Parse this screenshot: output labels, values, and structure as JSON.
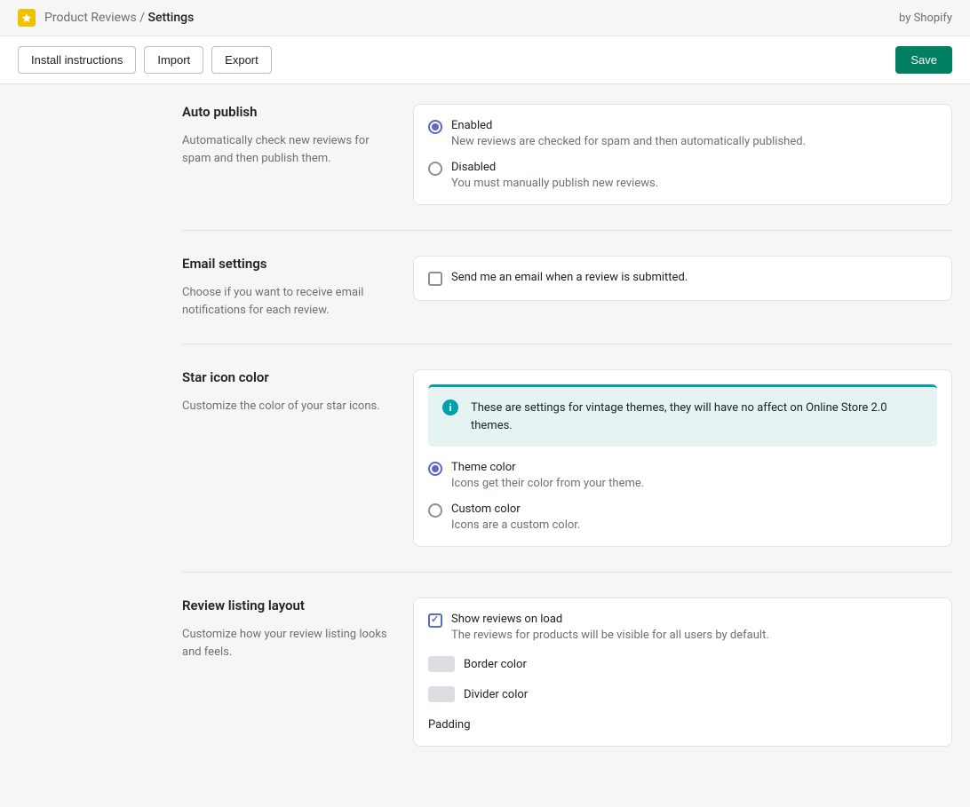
{
  "header": {
    "breadcrumb_parent": "Product Reviews",
    "breadcrumb_sep": " / ",
    "breadcrumb_current": "Settings",
    "by_shopify": "by Shopify"
  },
  "toolbar": {
    "install": "Install instructions",
    "import": "Import",
    "export": "Export",
    "save": "Save"
  },
  "sections": {
    "auto_publish": {
      "title": "Auto publish",
      "desc": "Automatically check new reviews for spam and then publish them.",
      "enabled_label": "Enabled",
      "enabled_desc": "New reviews are checked for spam and then automatically published.",
      "disabled_label": "Disabled",
      "disabled_desc": "You must manually publish new reviews."
    },
    "email": {
      "title": "Email settings",
      "desc": "Choose if you want to receive email notifications for each review.",
      "send_label": "Send me an email when a review is submitted."
    },
    "star": {
      "title": "Star icon color",
      "desc": "Customize the color of your star icons.",
      "banner": "These are settings for vintage themes, they will have no affect on Online Store 2.0 themes.",
      "theme_label": "Theme color",
      "theme_desc": "Icons get their color from your theme.",
      "custom_label": "Custom color",
      "custom_desc": "Icons are a custom color."
    },
    "layout": {
      "title": "Review listing layout",
      "desc": "Customize how your review listing looks and feels.",
      "show_label": "Show reviews on load",
      "show_desc": "The reviews for products will be visible for all users by default.",
      "border_label": "Border color",
      "divider_label": "Divider color",
      "padding_label": "Padding"
    }
  }
}
